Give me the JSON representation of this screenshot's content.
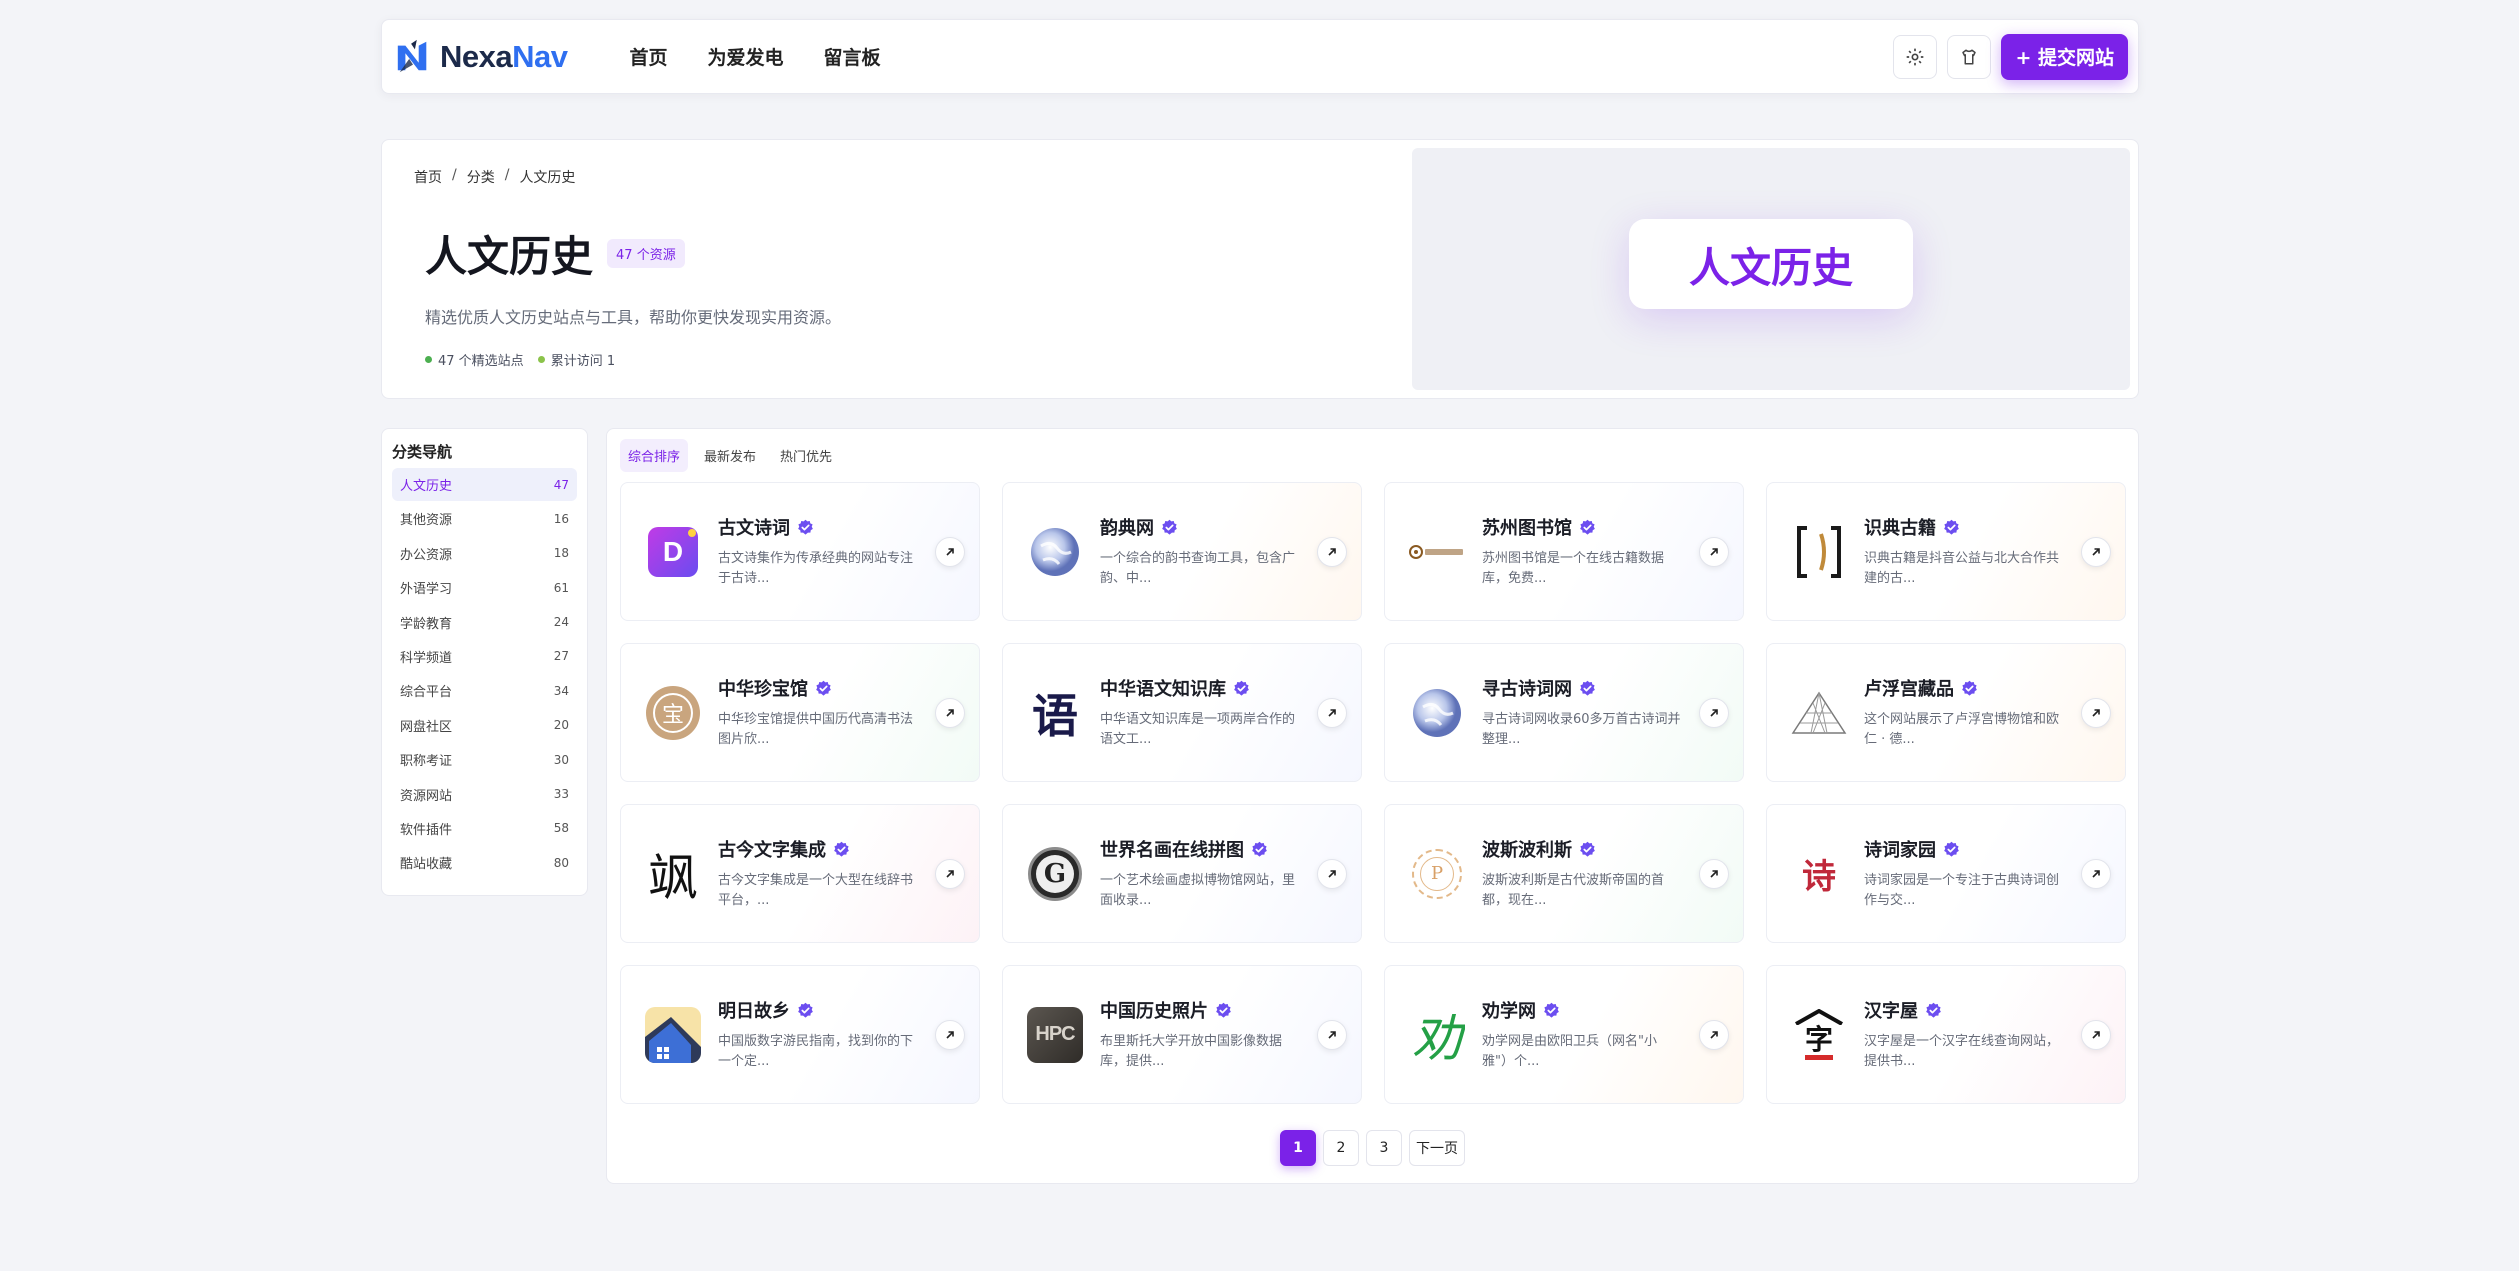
{
  "brand": {
    "name_part1": "Nexa",
    "name_part2": "Nav",
    "primary": "#7b22e8",
    "logo_blue": "#2f6ff0"
  },
  "nav": [
    "首页",
    "为爱发电",
    "留言板"
  ],
  "header": {
    "settings_icon": "gear-icon",
    "theme_icon": "shirt-icon",
    "submit_label": "+ 提交网站"
  },
  "breadcrumb": [
    "首页",
    "分类",
    "人文历史"
  ],
  "hero": {
    "title": "人文历史",
    "badge": "47 个资源",
    "desc": "精选优质人文历史站点与工具，帮助你更快发现实用资源。",
    "stats": [
      {
        "label": "47 个精选站点",
        "color": "#4caf50"
      },
      {
        "label": "累计访问 1",
        "color": "#8bc34a"
      }
    ],
    "visual_text": "人文历史"
  },
  "sidebar": {
    "title": "分类导航",
    "items": [
      {
        "label": "人文历史",
        "count": "47",
        "active": true
      },
      {
        "label": "其他资源",
        "count": "16"
      },
      {
        "label": "办公资源",
        "count": "18"
      },
      {
        "label": "外语学习",
        "count": "61"
      },
      {
        "label": "学龄教育",
        "count": "24"
      },
      {
        "label": "科学频道",
        "count": "27"
      },
      {
        "label": "综合平台",
        "count": "34"
      },
      {
        "label": "网盘社区",
        "count": "20"
      },
      {
        "label": "职称考证",
        "count": "30"
      },
      {
        "label": "资源网站",
        "count": "33"
      },
      {
        "label": "软件插件",
        "count": "58"
      },
      {
        "label": "酷站收藏",
        "count": "80"
      }
    ]
  },
  "tabs": [
    "综合排序",
    "最新发布",
    "热门优先"
  ],
  "cards": [
    {
      "title": "古文诗词",
      "desc": "古文诗集作为传承经典的网站专注于古诗...",
      "logo": "d-letter",
      "tone": "cool"
    },
    {
      "title": "韵典网",
      "desc": "一个综合的韵书查询工具，包含广韵、中...",
      "logo": "globe",
      "tone": "warm"
    },
    {
      "title": "苏州图书馆",
      "desc": "苏州图书馆是一个在线古籍数据库，免费...",
      "logo": "library-seal",
      "tone": "cool"
    },
    {
      "title": "识典古籍",
      "desc": "识典古籍是抖音公益与北大合作共建的古...",
      "logo": "brackets",
      "tone": "warm"
    },
    {
      "title": "中华珍宝馆",
      "desc": "中华珍宝馆提供中国历代高清书法图片欣...",
      "logo": "bao-seal",
      "tone": "green",
      "glyph": "宝"
    },
    {
      "title": "中华语文知识库",
      "desc": "中华语文知识库是一项两岸合作的语文工...",
      "logo": "yu-glyph",
      "tone": "cool",
      "glyph": "语"
    },
    {
      "title": "寻古诗词网",
      "desc": "寻古诗词网收录60多万首古诗词并整理...",
      "logo": "globe",
      "tone": "green"
    },
    {
      "title": "卢浮宫藏品",
      "desc": "这个网站展示了卢浮宫博物馆和欧仁 · 德...",
      "logo": "pyramid",
      "tone": "warm"
    },
    {
      "title": "古今文字集成",
      "desc": "古今文字集成是一个大型在线辞书平台，...",
      "logo": "calligraphy",
      "tone": "pink",
      "glyph": "飒"
    },
    {
      "title": "世界名画在线拼图",
      "desc": "一个艺术绘画虚拟博物馆网站，里面收录...",
      "logo": "g-badge",
      "tone": "cool",
      "glyph": "G"
    },
    {
      "title": "波斯波利斯",
      "desc": "波斯波利斯是古代波斯帝国的首都，现在...",
      "logo": "p-coin",
      "tone": "green",
      "glyph": "P"
    },
    {
      "title": "诗词家园",
      "desc": "诗词家园是一个专注于古典诗词创作与交...",
      "logo": "shi-seal",
      "tone": "cool",
      "glyph": "诗"
    },
    {
      "title": "明日故乡",
      "desc": "中国版数字游民指南，找到你的下一个定...",
      "logo": "house",
      "tone": "cool"
    },
    {
      "title": "中国历史照片",
      "desc": "布里斯托大学开放中国影像数据库，提供...",
      "logo": "hpc",
      "tone": "cool",
      "glyph": "HPC"
    },
    {
      "title": "劝学网",
      "desc": "劝学网是由欧阳卫兵（网名\"小雅\"）个...",
      "logo": "quan-glyph",
      "tone": "warm",
      "glyph": "劝"
    },
    {
      "title": "汉字屋",
      "desc": "汉字屋是一个汉字在线查询网站，提供书...",
      "logo": "zi-house",
      "tone": "pink",
      "glyph": "字"
    }
  ],
  "pagination": {
    "pages": [
      "1",
      "2",
      "3"
    ],
    "current": "1",
    "next": "下一页"
  }
}
